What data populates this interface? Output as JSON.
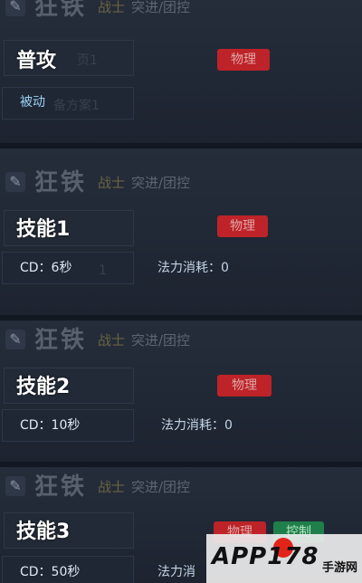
{
  "hero": {
    "name": "狂铁",
    "role": "战士",
    "tags": "突进/团控",
    "icon": "pin-icon"
  },
  "skills": [
    {
      "title": "普攻",
      "ghost_text": "页1",
      "info_left": "被动",
      "info_ghost": "备方案1",
      "badges": [
        "物理"
      ]
    },
    {
      "title": "技能1",
      "ghost_text": "",
      "info_left": "CD：6秒",
      "info_ghost": "1",
      "info_right": "法力消耗：0",
      "badges": [
        "物理"
      ]
    },
    {
      "title": "技能2",
      "ghost_text": "",
      "info_left": "CD：10秒",
      "info_right": "法力消耗：0",
      "badges": [
        "物理"
      ]
    },
    {
      "title": "技能3",
      "ghost_text": "",
      "info_left": "CD：50秒",
      "info_right": "法力消",
      "badges": [
        "物理",
        "控制"
      ]
    }
  ],
  "watermark": {
    "main": "APP178",
    "sub": "手游网"
  },
  "colors": {
    "physical": "#bd2328",
    "control": "#1f7f4a"
  }
}
